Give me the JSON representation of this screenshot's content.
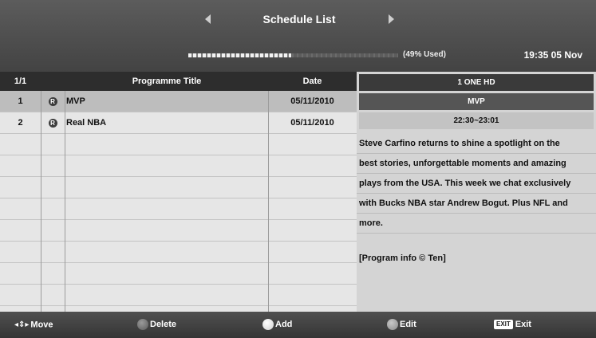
{
  "header": {
    "title": "Schedule List",
    "disk_used_fraction": 0.49,
    "disk_used_label": "(49% Used)",
    "clock": "19:35 05 Nov"
  },
  "table": {
    "page": "1/1",
    "col_title": "Programme Title",
    "col_date": "Date",
    "rows": [
      {
        "num": "1",
        "title": "MVP",
        "date": "05/11/2010",
        "selected": true
      },
      {
        "num": "2",
        "title": "Real NBA",
        "date": "05/11/2010",
        "selected": false
      }
    ]
  },
  "info": {
    "channel": "1 ONE HD",
    "programme": "MVP",
    "time": "22:30~23:01",
    "desc_lines": [
      "Steve Carfino returns to shine a spotlight on the",
      "best stories, unforgettable moments and amazing",
      "plays from the USA. This week we chat exclusively",
      "with Bucks NBA star Andrew Bogut. Plus NFL and",
      "more."
    ],
    "credit": "[Program info © Ten]"
  },
  "footer": {
    "move": "Move",
    "delete": "Delete",
    "add": "Add",
    "edit": "Edit",
    "exit_key": "EXIT",
    "exit": "Exit"
  },
  "icons": {
    "record": "R",
    "scroll_up": "▲",
    "scroll_down": "▼",
    "move": "◂⇕▸"
  }
}
